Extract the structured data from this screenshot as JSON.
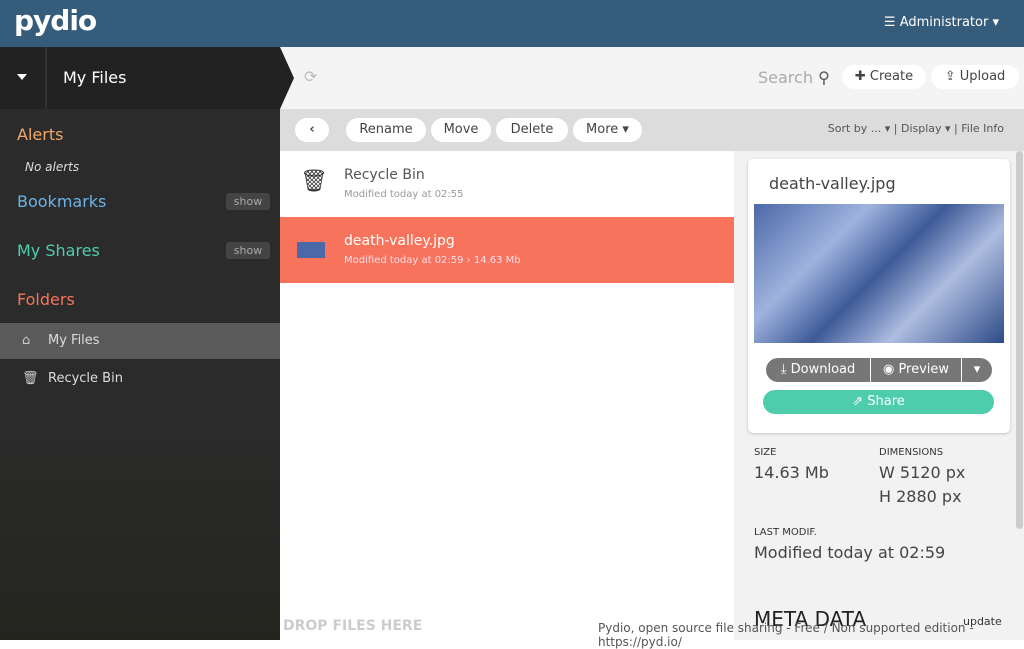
{
  "header": {
    "logo": "pydio",
    "user": "☰ Administrator ▾"
  },
  "breadcrumb": {
    "current": "My Files"
  },
  "sidebar": {
    "alerts": "Alerts",
    "no_alerts": "No alerts",
    "bookmarks": "Bookmarks",
    "my_shares": "My Shares",
    "show": "show",
    "folders": "Folders",
    "items": [
      {
        "label": "My Files",
        "icon": "home-icon"
      },
      {
        "label": "Recycle Bin",
        "icon": "trash-icon"
      }
    ]
  },
  "toolbar": {
    "search": "Search",
    "create": "Create",
    "upload": "Upload",
    "rename": "Rename",
    "move": "Move",
    "delete": "Delete",
    "more": "More ▾",
    "sort": "Sort by ... ▾",
    "display": "Display ▾",
    "file_info": "File Info"
  },
  "files": [
    {
      "name": "Recycle Bin",
      "meta": "Modified today at 02:55"
    },
    {
      "name": "death-valley.jpg",
      "meta": "Modified today at 02:59 › 14.63 Mb"
    }
  ],
  "info": {
    "title": "death-valley.jpg",
    "download": "Download",
    "preview": "Preview",
    "share": "Share",
    "size_label": "SIZE",
    "size": "14.63 Mb",
    "dim_label": "DIMENSIONS",
    "width": "W 5120 px",
    "height": "H 2880 px",
    "modif_label": "LAST MODIF.",
    "modif": "Modified today at 02:59",
    "meta": "META DATA",
    "update": "update"
  },
  "footer": {
    "drop": "DROP FILES HERE",
    "text": "Pydio, open source file sharing - Free / Non supported edition - https://pyd.io/"
  },
  "colors": {
    "header": "#365c7b",
    "selected": "#f7735b",
    "share": "#4ecdac"
  }
}
